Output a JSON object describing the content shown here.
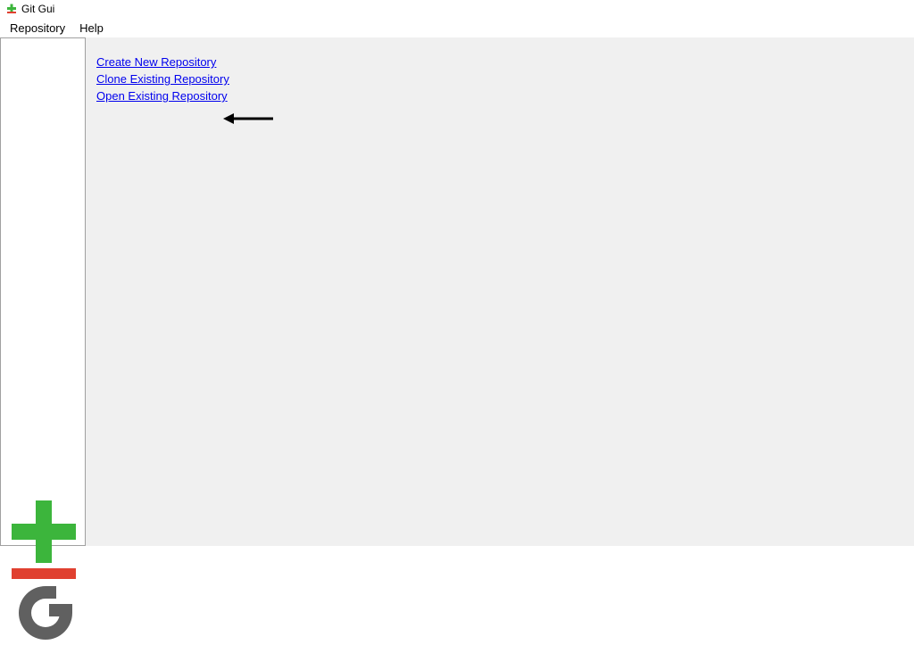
{
  "window": {
    "title": "Git Gui"
  },
  "menubar": {
    "items": [
      "Repository",
      "Help"
    ]
  },
  "actions": {
    "create": "Create New Repository",
    "clone": "Clone Existing Repository",
    "open": "Open Existing Repository"
  },
  "colors": {
    "link": "#0000EE",
    "panel_bg": "#f0f0f0",
    "logo_green": "#3cb53c",
    "logo_red": "#e04030",
    "logo_gray": "#606060"
  }
}
